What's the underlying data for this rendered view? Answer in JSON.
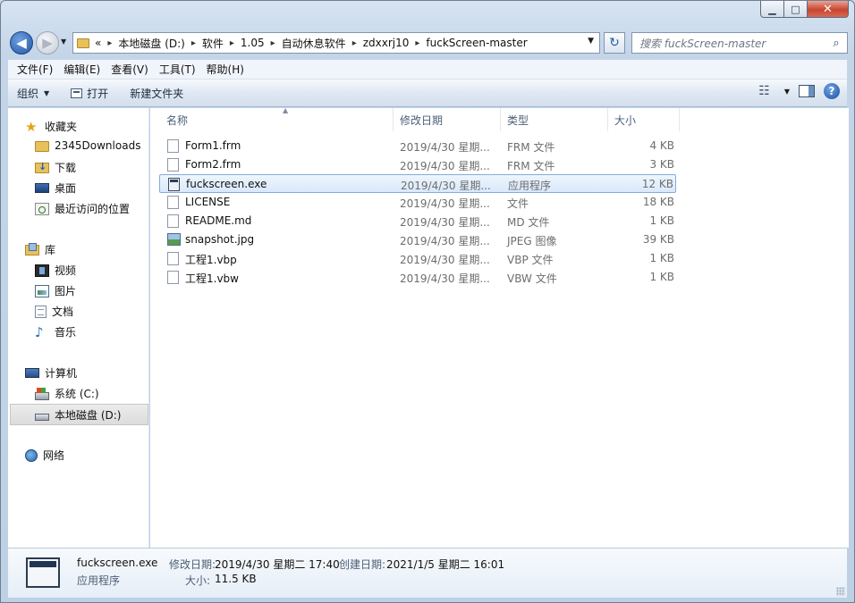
{
  "window": {
    "caption": {
      "minimize": "▁",
      "maximize": "□",
      "close": "✕"
    }
  },
  "nav": {
    "back_glyph": "◀",
    "forward_glyph": "▶",
    "history_glyph": "▼",
    "refresh_glyph": "↻",
    "breadcrumbs": [
      "«",
      "本地磁盘 (D:)",
      "软件",
      "1.05",
      "自动休息软件",
      "zdxxrj10",
      "fuckScreen-master"
    ],
    "crumb_separator": "▸",
    "dropdown_glyph": "▼"
  },
  "search": {
    "placeholder": "搜索 fuckScreen-master",
    "icon_glyph": "⌕"
  },
  "menu": [
    "文件(F)",
    "编辑(E)",
    "查看(V)",
    "工具(T)",
    "帮助(H)"
  ],
  "commands": {
    "organize": "组织",
    "open": "打开",
    "new_folder": "新建文件夹",
    "caret": "▼",
    "views_glyph": "☷",
    "help_glyph": "?"
  },
  "sidebar": {
    "favorites": {
      "label": "收藏夹",
      "items": [
        "2345Downloads",
        "下载",
        "桌面",
        "最近访问的位置"
      ]
    },
    "libraries": {
      "label": "库",
      "items": [
        "视频",
        "图片",
        "文档",
        "音乐"
      ]
    },
    "computer": {
      "label": "计算机",
      "items": [
        "系统 (C:)",
        "本地磁盘 (D:)"
      ]
    },
    "network": {
      "label": "网络"
    },
    "star_glyph": "★",
    "music_glyph": "♪"
  },
  "file_list": {
    "columns": [
      "名称",
      "修改日期",
      "类型",
      "大小"
    ],
    "sort_glyph": "▲",
    "rows": [
      {
        "name": "Form1.frm",
        "date": "2019/4/30 星期...",
        "type": "FRM 文件",
        "size": "4 KB"
      },
      {
        "name": "Form2.frm",
        "date": "2019/4/30 星期...",
        "type": "FRM 文件",
        "size": "3 KB"
      },
      {
        "name": "fuckscreen.exe",
        "date": "2019/4/30 星期...",
        "type": "应用程序",
        "size": "12 KB"
      },
      {
        "name": "LICENSE",
        "date": "2019/4/30 星期...",
        "type": "文件",
        "size": "18 KB"
      },
      {
        "name": "README.md",
        "date": "2019/4/30 星期...",
        "type": "MD 文件",
        "size": "1 KB"
      },
      {
        "name": "snapshot.jpg",
        "date": "2019/4/30 星期...",
        "type": "JPEG 图像",
        "size": "39 KB"
      },
      {
        "name": "工程1.vbp",
        "date": "2019/4/30 星期...",
        "type": "VBP 文件",
        "size": "1 KB"
      },
      {
        "name": "工程1.vbw",
        "date": "2019/4/30 星期...",
        "type": "VBW 文件",
        "size": "1 KB"
      }
    ],
    "selected_index": 2
  },
  "details": {
    "name": "fuckscreen.exe",
    "type": "应用程序",
    "modified_label": "修改日期:",
    "modified_value": "2019/4/30 星期二 17:40",
    "created_label": "创建日期:",
    "created_value": "2021/1/5 星期二 16:01",
    "size_label": "大小:",
    "size_value": "11.5 KB"
  },
  "colors": {
    "accent": "#1f56a8",
    "selection": "#d9e9fb",
    "selection_border": "#84acdd"
  }
}
